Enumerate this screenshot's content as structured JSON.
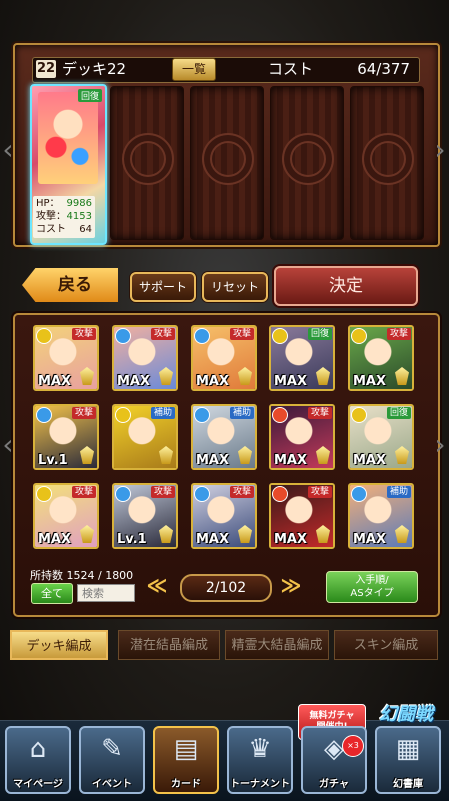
{
  "deck": {
    "number": "22",
    "name": "デッキ22",
    "list_label": "一覧",
    "cost_label": "コスト",
    "cost_value": "64/377"
  },
  "leader": {
    "type": "回復",
    "hp_label": "HP：",
    "hp": "9986",
    "atk_label": "攻撃：",
    "atk": "4153",
    "cost_label": "コスト",
    "cost": "64"
  },
  "actions": {
    "back": "戻る",
    "support": "サポート",
    "reset": "リセット",
    "confirm": "決定"
  },
  "cards": [
    {
      "type": "攻撃",
      "level": "MAX",
      "type_color": "#c42a2a",
      "elem": "#e8c21a",
      "art": [
        "#f3d27a",
        "#e8a0a0"
      ]
    },
    {
      "type": "攻撃",
      "level": "MAX",
      "type_color": "#c42a2a",
      "elem": "#3a9ae8",
      "art": [
        "#f0b0a0",
        "#6a8ad8"
      ]
    },
    {
      "type": "攻撃",
      "level": "MAX",
      "type_color": "#c42a2a",
      "elem": "#3a9ae8",
      "art": [
        "#f6c06a",
        "#e07a3a"
      ]
    },
    {
      "type": "回復",
      "level": "MAX",
      "type_color": "#2a9a3a",
      "elem": "#e8c21a",
      "art": [
        "#8a7a9a",
        "#3a3a5a"
      ]
    },
    {
      "type": "攻撃",
      "level": "MAX",
      "type_color": "#c42a2a",
      "elem": "#e8c21a",
      "art": [
        "#6aa84a",
        "#2a4a2a"
      ]
    },
    {
      "type": "攻撃",
      "level": "Lv.1",
      "type_color": "#c42a2a",
      "elem": "#3a9ae8",
      "art": [
        "#f3c24a",
        "#2a2a3a"
      ]
    },
    {
      "type": "補助",
      "level": "",
      "type_color": "#2a6ac4",
      "elem": "#e8c21a",
      "art": [
        "#f3d22a",
        "#a87a1a"
      ]
    },
    {
      "type": "補助",
      "level": "MAX",
      "type_color": "#2a6ac4",
      "elem": "#3a9ae8",
      "art": [
        "#d0d8e0",
        "#6a7a8a"
      ]
    },
    {
      "type": "攻撃",
      "level": "MAX",
      "type_color": "#c42a2a",
      "elem": "#e84a2a",
      "art": [
        "#3a1a3a",
        "#c43a5a"
      ]
    },
    {
      "type": "回復",
      "level": "MAX",
      "type_color": "#2a9a3a",
      "elem": "#e8c21a",
      "art": [
        "#e8e0c8",
        "#9aa88a"
      ]
    },
    {
      "type": "攻撃",
      "level": "MAX",
      "type_color": "#c42a2a",
      "elem": "#e8c21a",
      "art": [
        "#f3e07a",
        "#e0a0c0"
      ]
    },
    {
      "type": "攻撃",
      "level": "Lv.1",
      "type_color": "#c42a2a",
      "elem": "#3a9ae8",
      "art": [
        "#c0c8d8",
        "#2a2a3a"
      ]
    },
    {
      "type": "攻撃",
      "level": "MAX",
      "type_color": "#c42a2a",
      "elem": "#3a9ae8",
      "art": [
        "#d0d0e0",
        "#3a4a7a"
      ]
    },
    {
      "type": "攻撃",
      "level": "MAX",
      "type_color": "#c42a2a",
      "elem": "#e84a2a",
      "art": [
        "#3a1a1a",
        "#c42a2a"
      ]
    },
    {
      "type": "補助",
      "level": "MAX",
      "type_color": "#2a6ac4",
      "elem": "#3a9ae8",
      "art": [
        "#f3b07a",
        "#5a7ab8"
      ]
    }
  ],
  "pager": {
    "count_label": "所持数 1524 / 1800",
    "all_label": "全て",
    "search_placeholder": "検索",
    "prev": "≪",
    "page": "2/102",
    "next": "≫",
    "sort_line1": "入手順/",
    "sort_line2": "ASタイプ"
  },
  "tabs": [
    "デッキ編成",
    "潜在結晶編成",
    "精霊大結晶編成",
    "スキン編成"
  ],
  "promo": {
    "free_line1": "無料ガチャ",
    "free_line2": "開催中!",
    "event_logo": "幻闘戦",
    "gacha_badge": "×3"
  },
  "nav": [
    {
      "label": "マイページ",
      "glyph": "⌂"
    },
    {
      "label": "イベント",
      "glyph": "✎"
    },
    {
      "label": "カード",
      "glyph": "▤"
    },
    {
      "label": "トーナメント",
      "glyph": "♛"
    },
    {
      "label": "ガチャ",
      "glyph": "◈"
    },
    {
      "label": "幻書庫",
      "glyph": "▦"
    }
  ]
}
